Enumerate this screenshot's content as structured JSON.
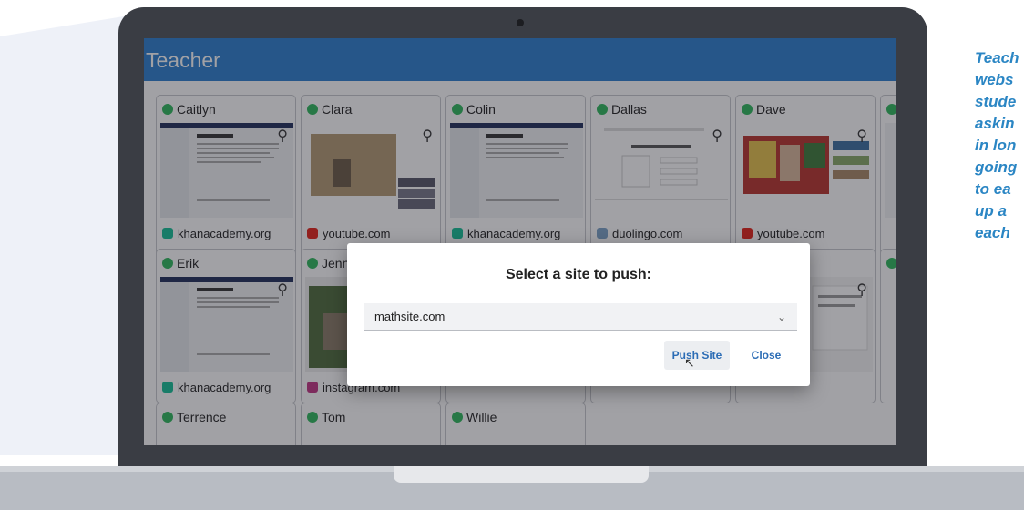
{
  "app": {
    "title": "Teacher"
  },
  "students": [
    {
      "name": "Caitlyn",
      "site": "khanacademy.org",
      "site_icon": "khan-icon"
    },
    {
      "name": "Clara",
      "site": "youtube.com",
      "site_icon": "youtube-icon"
    },
    {
      "name": "Colin",
      "site": "khanacademy.org",
      "site_icon": "khan-icon"
    },
    {
      "name": "Dallas",
      "site": "duolingo.com",
      "site_icon": "duolingo-icon"
    },
    {
      "name": "Dave",
      "site": "youtube.com",
      "site_icon": "youtube-icon"
    },
    {
      "name": "Erik",
      "site": "khanacademy.org",
      "site_icon": "khan-icon"
    },
    {
      "name": "Jenn",
      "site": "instagram.com",
      "site_icon": "instagram-icon"
    },
    {
      "name": "Terrence"
    },
    {
      "name": "Tom"
    },
    {
      "name": "Willie"
    }
  ],
  "status_color": "#2eb85c",
  "modal": {
    "title": "Select a site to push:",
    "selected_site": "mathsite.com",
    "push_label": "Push Site",
    "close_label": "Close"
  },
  "side_text": {
    "lines": [
      "Teach",
      "webs",
      "stude",
      "askin",
      "in lon",
      "going",
      "to ea",
      "up a",
      "each"
    ]
  },
  "colors": {
    "header": "#2c7fcf",
    "accent_text": "#2b86c4",
    "button_text": "#2b6cb5"
  }
}
